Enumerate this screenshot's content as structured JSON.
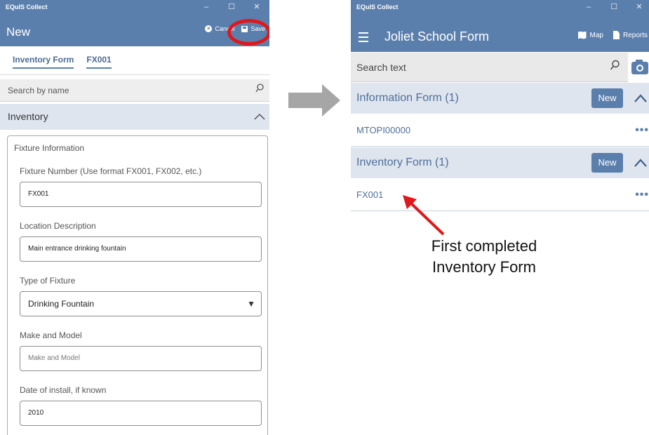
{
  "left": {
    "window_title": "EQuIS Collect",
    "window_controls": [
      "–",
      "☐",
      "✕"
    ],
    "page_title": "New",
    "cancel_label": "Cancel",
    "save_label": "Save",
    "breadcrumb": [
      "Inventory Form",
      "FX001"
    ],
    "search_placeholder": "Search by name",
    "section_title": "Inventory",
    "card_title": "Fixture Information",
    "fields": [
      {
        "label": "Fixture Number (Use format FX001, FX002, etc.)",
        "value": "FX001"
      },
      {
        "label": "Location Description",
        "value": "Main entrance drinking fountain"
      },
      {
        "label": "Type of Fixture",
        "value": "Drinking Fountain"
      },
      {
        "label": "Make and Model",
        "placeholder": "Make and Model"
      },
      {
        "label": "Date of install, if known",
        "value": "2010"
      }
    ]
  },
  "right": {
    "window_title": "EQuIS Collect",
    "window_controls": [
      "–",
      "☐",
      "✕"
    ],
    "page_title": "Joliet School Form",
    "map_label": "Map",
    "reports_label": "Reports",
    "search_placeholder": "Search text",
    "groups": [
      {
        "title": "Information Form (1)",
        "new_label": "New",
        "items": [
          "MTOPI00000"
        ]
      },
      {
        "title": "Inventory Form (1)",
        "new_label": "New",
        "items": [
          "FX001"
        ]
      }
    ]
  },
  "annotation": {
    "line1": "First completed",
    "line2": "Inventory Form"
  },
  "colors": {
    "accent": "#5b7fad",
    "section_bg": "#dfe5ef",
    "highlight_red": "#e0181b",
    "arrow_gray": "#a6a6a6"
  }
}
